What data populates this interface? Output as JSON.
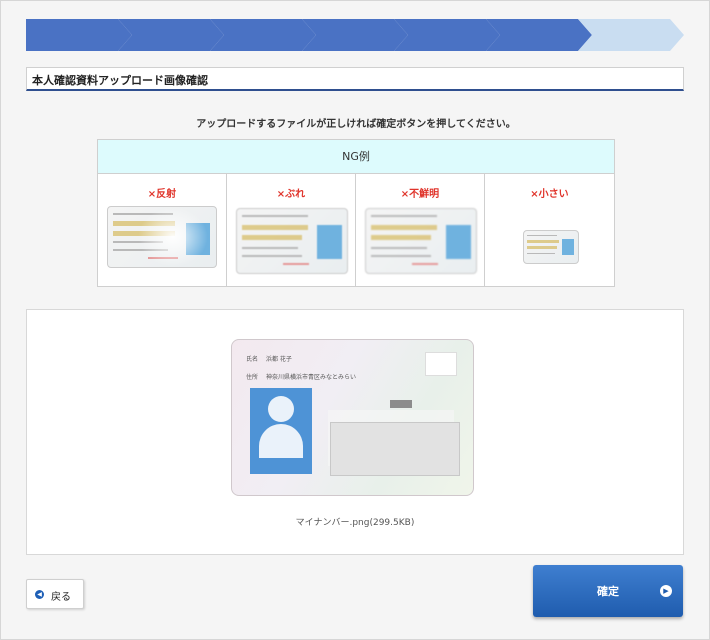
{
  "progress": {
    "total_steps": 7,
    "completed_steps": 6,
    "colors": {
      "done": "#4a72c4",
      "pending": "#c9ddf1"
    }
  },
  "page": {
    "title": "本人確認資料アップロード画像確認",
    "instruction": "アップロードするファイルが正しければ確定ボタンを押してください。"
  },
  "ng_examples": {
    "header": "NG例",
    "items": [
      {
        "label": "×反射",
        "icon": "id-card-glare"
      },
      {
        "label": "×ぶれ",
        "icon": "id-card-blur"
      },
      {
        "label": "×不鮮明",
        "icon": "id-card-unclear"
      },
      {
        "label": "×小さい",
        "icon": "id-card-small"
      }
    ],
    "label_color": "#e0342b"
  },
  "preview": {
    "file_name": "マイナンバー.png(299.5KB)",
    "card": {
      "name_label": "氏名",
      "name_value": "浜都 花子",
      "address_label": "住所",
      "address_value": "神奈川県横浜市青区みなとみらい"
    }
  },
  "buttons": {
    "back_label": "戻る",
    "confirm_label": "確定"
  },
  "colors": {
    "primary": "#1f5cae",
    "title_rule": "#2f4f8f",
    "ng_header_bg": "#ddfbfd"
  }
}
